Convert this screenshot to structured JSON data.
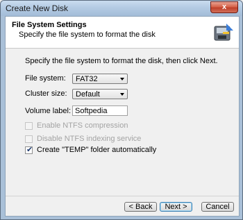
{
  "window": {
    "title": "Create New Disk",
    "close_label": "x"
  },
  "header": {
    "title": "File System Settings",
    "subtitle": "Specify the file system to format the disk",
    "icon": "disk-format-icon"
  },
  "main": {
    "instruction": "Specify the file system to format the disk, then click Next.",
    "file_system": {
      "label": "File system:",
      "value": "FAT32"
    },
    "cluster_size": {
      "label": "Cluster size:",
      "value": "Default"
    },
    "volume_label": {
      "label": "Volume label:",
      "value": "Softpedia"
    },
    "options": [
      {
        "label": "Enable NTFS compression",
        "checked": false,
        "enabled": false
      },
      {
        "label": "Disable NTFS indexing service",
        "checked": false,
        "enabled": false
      },
      {
        "label": "Create \"TEMP\" folder automatically",
        "checked": true,
        "enabled": true
      }
    ]
  },
  "buttons": {
    "back": "< Back",
    "next": "Next >",
    "cancel": "Cancel"
  },
  "colors": {
    "titlebar": "#b4cbe3",
    "close": "#c0402a",
    "default_button_border": "#3c7fb1"
  }
}
